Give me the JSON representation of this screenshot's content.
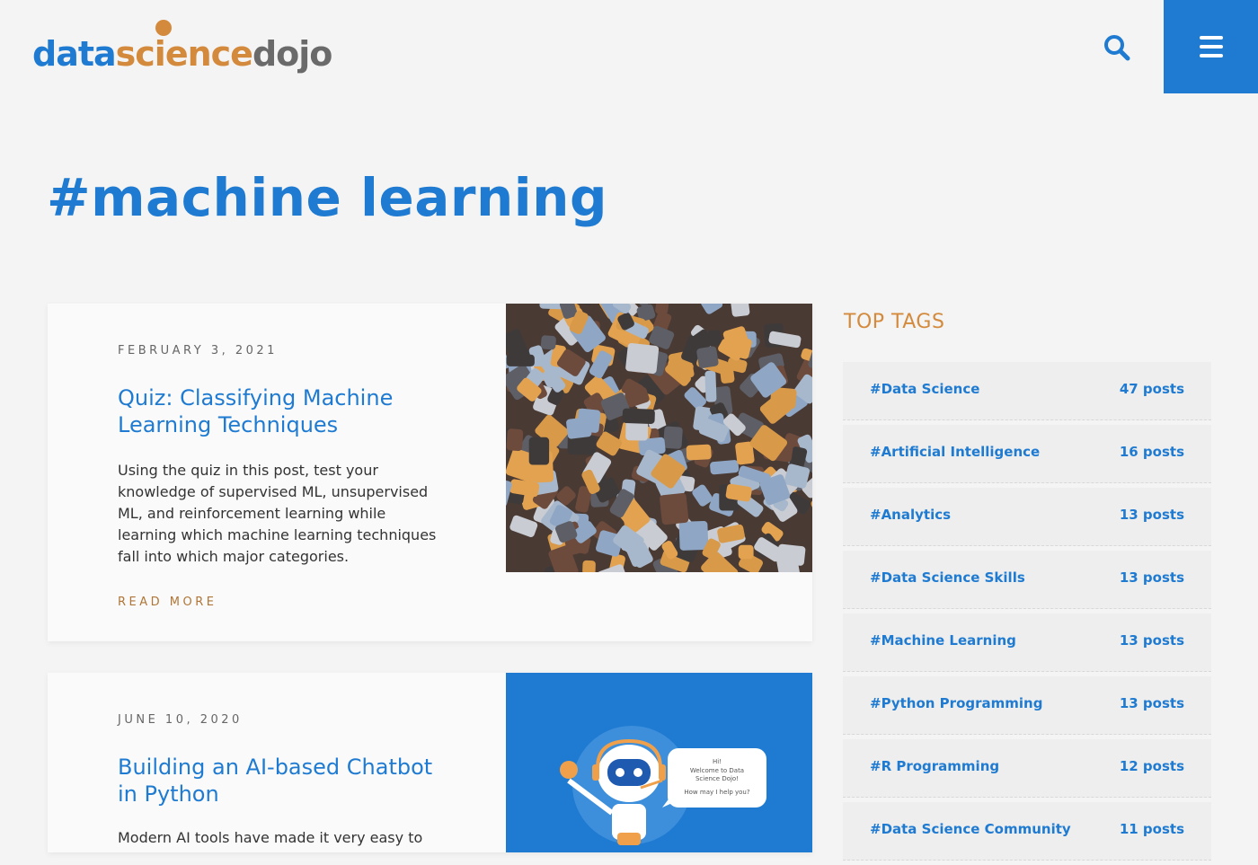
{
  "header": {
    "logo_parts": [
      "data",
      "science",
      "dojo"
    ],
    "search_icon": "search-icon",
    "menu_icon": "hamburger-menu-icon"
  },
  "page_title": "#machine learning",
  "posts": [
    {
      "date": "FEBRUARY 3, 2021",
      "title": "Quiz: Classifying Machine Learning Techniques",
      "excerpt": "Using the quiz in this post, test your knowledge of supervised ML, unsupervised ML, and reinforcement learning while learning which machine learning techniques fall into which major categories.",
      "read_more": "READ MORE"
    },
    {
      "date": "JUNE 10, 2020",
      "title": "Building an AI-based Chatbot in Python",
      "excerpt": "Modern AI tools have made it very easy to",
      "bubble_line1": "Hi!",
      "bubble_line2": "Welcome to Data",
      "bubble_line3": "Science Dojo!",
      "bubble_line4": "How may I help you?"
    }
  ],
  "sidebar": {
    "title": "TOP TAGS",
    "tags": [
      {
        "name": "#Data Science",
        "count": "47 posts"
      },
      {
        "name": "#Artificial Intelligence",
        "count": "16 posts"
      },
      {
        "name": "#Analytics",
        "count": "13 posts"
      },
      {
        "name": "#Data Science Skills",
        "count": "13 posts"
      },
      {
        "name": "#Machine Learning",
        "count": "13 posts"
      },
      {
        "name": "#Python Programming",
        "count": "13 posts"
      },
      {
        "name": "#R Programming",
        "count": "12 posts"
      },
      {
        "name": "#Data Science Community",
        "count": "11 posts"
      }
    ]
  },
  "colors": {
    "brand_blue": "#1f7bd1",
    "brand_orange": "#d48a3c",
    "background": "#f4f4f4"
  }
}
